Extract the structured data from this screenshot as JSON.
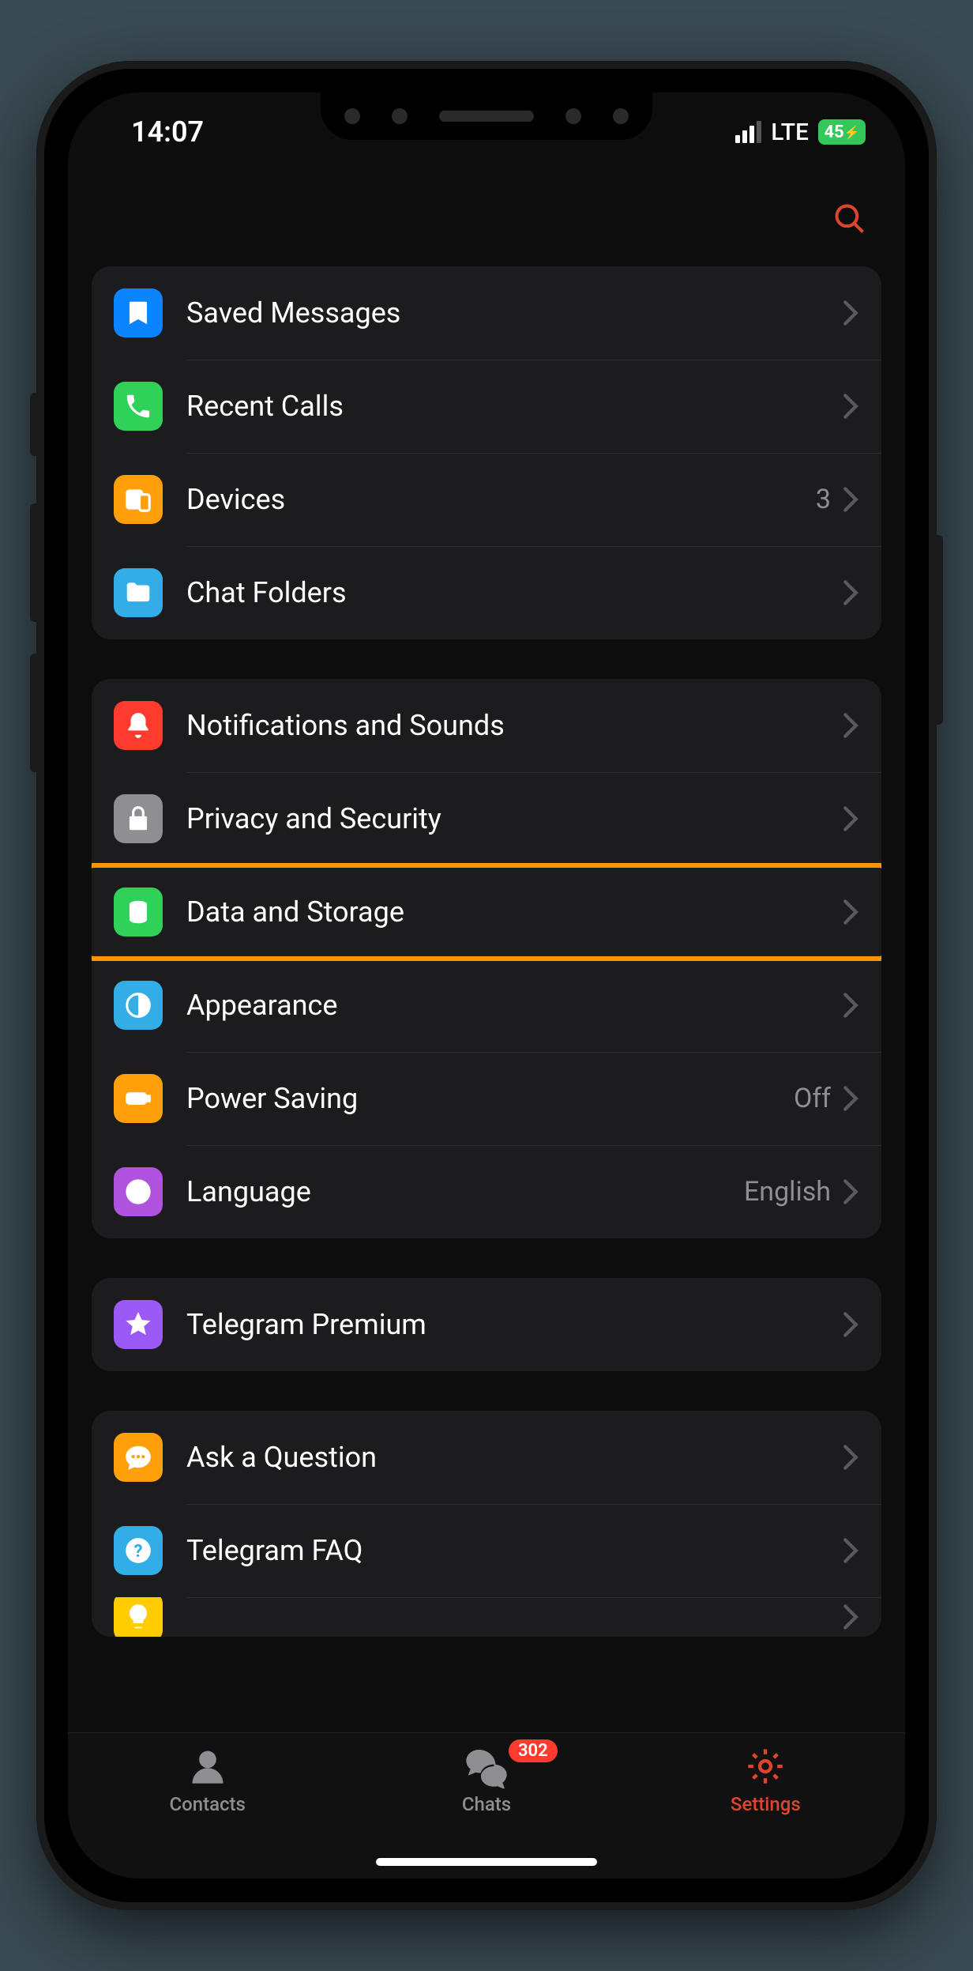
{
  "statusbar": {
    "time": "14:07",
    "network": "LTE",
    "battery": "45"
  },
  "groups": [
    {
      "items": [
        {
          "id": "saved-messages",
          "label": "Saved Messages",
          "icon": "bookmark",
          "color": "#0a84ff"
        },
        {
          "id": "recent-calls",
          "label": "Recent Calls",
          "icon": "phone",
          "color": "#30d158"
        },
        {
          "id": "devices",
          "label": "Devices",
          "icon": "devices",
          "color": "#ff9f0a",
          "value": "3"
        },
        {
          "id": "chat-folders",
          "label": "Chat Folders",
          "icon": "folder",
          "color": "#32ade6"
        }
      ]
    },
    {
      "items": [
        {
          "id": "notifications",
          "label": "Notifications and Sounds",
          "icon": "bell",
          "color": "#ff3b30"
        },
        {
          "id": "privacy",
          "label": "Privacy and Security",
          "icon": "lock",
          "color": "#8e8e93"
        },
        {
          "id": "data-storage",
          "label": "Data and Storage",
          "icon": "storage",
          "color": "#30d158",
          "highlighted": true
        },
        {
          "id": "appearance",
          "label": "Appearance",
          "icon": "contrast",
          "color": "#32ade6"
        },
        {
          "id": "power-saving",
          "label": "Power Saving",
          "icon": "battery",
          "color": "#ff9f0a",
          "value": "Off"
        },
        {
          "id": "language",
          "label": "Language",
          "icon": "globe",
          "color": "#af52de",
          "value": "English"
        }
      ]
    },
    {
      "items": [
        {
          "id": "premium",
          "label": "Telegram Premium",
          "icon": "star",
          "color": "#9b59f6"
        }
      ]
    },
    {
      "items": [
        {
          "id": "ask-question",
          "label": "Ask a Question",
          "icon": "chat",
          "color": "#ff9f0a"
        },
        {
          "id": "faq",
          "label": "Telegram FAQ",
          "icon": "help",
          "color": "#32ade6"
        },
        {
          "id": "features",
          "label": "",
          "icon": "bulb",
          "color": "#ffcc00",
          "partial": true
        }
      ]
    }
  ],
  "tabs": [
    {
      "id": "contacts",
      "label": "Contacts",
      "icon": "person"
    },
    {
      "id": "chats",
      "label": "Chats",
      "icon": "chats",
      "badge": "302"
    },
    {
      "id": "settings",
      "label": "Settings",
      "icon": "gear",
      "active": true
    }
  ]
}
